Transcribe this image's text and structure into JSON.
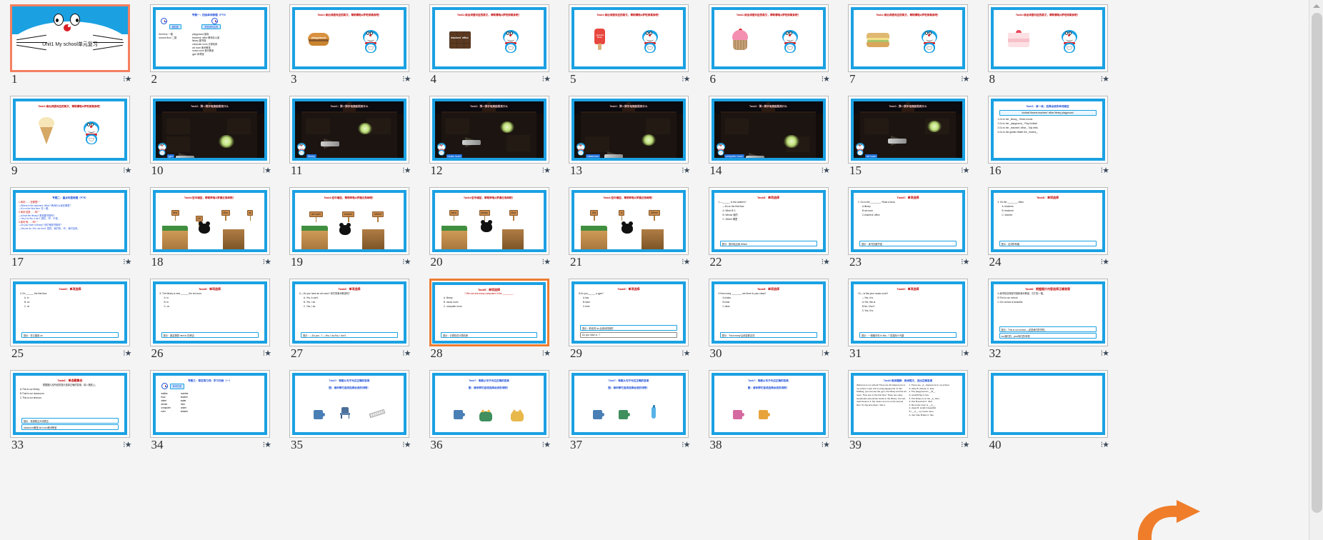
{
  "app": {
    "view": "slide-sorter",
    "accent_selected": "#ed7d31",
    "slide_border": "#1ba1e2",
    "background": "#f4f4f4"
  },
  "scrollbar": {
    "up_arrow": "▲",
    "position": "top"
  },
  "slide1": {
    "title": "Unit1  My school单元复习"
  },
  "slide2": {
    "title": "专题一：四会单词梳理（P70）",
    "col1_label": "楼层数",
    "col2_label": "学校场所名称",
    "col1": [
      "first floor 一楼",
      "second floor 二楼"
    ],
    "col2": [
      "playground 操场",
      "teachers' office 教师办公室",
      "library 图书馆",
      "computer room 计算机房",
      "art room 美术教室",
      "music room 音乐教室",
      "gym 体育馆"
    ]
  },
  "task1": {
    "title": "Task1:读出词语对应的英文，帮助哪啦A梦吃掉美食吧！",
    "items": [
      {
        "n": 3,
        "word": "playground",
        "food": "burger"
      },
      {
        "n": 4,
        "word": "teachers' office",
        "food": "chocolate"
      },
      {
        "n": 5,
        "word": "second floor",
        "food": "popsicle"
      },
      {
        "n": 6,
        "word": "",
        "food": "cupcake"
      },
      {
        "n": 7,
        "word": "",
        "food": "sandwich"
      },
      {
        "n": 8,
        "word": "",
        "food": "cake"
      },
      {
        "n": 9,
        "word": "",
        "food": "ice-cream"
      }
    ]
  },
  "task2": {
    "title": "Task2：猜一猜手电筒能照亮什么",
    "tags": [
      "gym",
      "library",
      "music room",
      "classroom",
      "computer room",
      "art room"
    ],
    "slides": [
      10,
      11,
      12,
      13,
      14,
      15
    ]
  },
  "slide16": {
    "title": "Task3：读一读，选择合适的单词填空",
    "wordbank": "football   flowers   teachers' office   library   playground",
    "lines": [
      "1.Go to the _library_. Read a book.",
      "2.Go to the _playground_. Play football.",
      "3.Go to the _teachers' office_. Say hello.",
      "4.Go to the garden.Water the _flowers_."
    ]
  },
  "slide17": {
    "title": "专题二：重点句型梳理（P75）",
    "lines": [
      "1.询问“……在哪里？”",
      "—Where is the teachers' office?  教师办公室在哪里？",
      "—It's on the first floor.  在一楼。",
      "2.询问“这是……吗？”",
      "—Is that the library?  那是图书馆吗？",
      "—Yes,it is./No, it isn't.  是的。/不，不是。",
      "3.询问“有……吗？”",
      "—Do you have a library?  你们有图书馆吗？",
      "—Yes,we do. /No, we don't.  是的，我们有。/不，我们没有。"
    ]
  },
  "task4": {
    "title": "Task4:空中填空，帮助哆啦A梦通过岛屿吧！",
    "signs": [
      [
        "first",
        "the",
        "floor",
        "at"
      ],
      [
        "art room",
        "teacher",
        "Where",
        ""
      ],
      [
        "have",
        "library",
        "",
        ""
      ],
      [
        "this",
        "is",
        "",
        ""
      ]
    ],
    "slides": [
      18,
      19,
      20,
      21
    ]
  },
  "task5": {
    "title": "Task5：单项选择",
    "slides": [
      {
        "n": 22,
        "q": "1.—______ is the canteen?",
        "a": "—It's on the first floor.",
        "opts": [
          "A. What  什么",
          "B. Whose  谁的",
          "C. Where  哪里"
        ],
        "tip": "提示：提问地点用 Where"
      },
      {
        "n": 23,
        "q": "2. Go to the ________. Read a book.",
        "opts": [
          "A.library",
          "B.art room",
          "C.teachers' office"
        ],
        "tip": "提示：读书去图书馆"
      },
      {
        "n": 24,
        "q": "3. It's the ________ office.",
        "opts": [
          "A. teachers",
          "B. teachers'",
          "C. teacher"
        ],
        "tip": "提示：名词所有格"
      },
      {
        "n": 25,
        "q": "4. It's ______ the first floor.",
        "opts": [
          "A. in",
          "B. on",
          "C. at"
        ],
        "tip": "提示：在几楼用 on"
      },
      {
        "n": 26,
        "q": "5. The library is next ______ the art room.",
        "opts": [
          "A. in",
          "B. to",
          "C. on"
        ],
        "tip": "提示：固定搭配 next to 在旁边"
      },
      {
        "n": 27,
        "q": "6.—Do you have an art room? 你们有美术教室吗？",
        "opts": [
          "A. Yes, it can't.",
          "B. Yes, I do.",
          "C. Yes, I do."
        ],
        "tip": "提示：—Do you...? —Yes, I do./No, I don't."
      },
      {
        "n": 28,
        "q": "7.We can see many computers in the ________.",
        "opts": [
          "A. library",
          "B. music room",
          "C. computer room"
        ],
        "tip": "提示：计算机在计算机房",
        "selected": true
      },
      {
        "n": 29,
        "q": "8.Do you______ a gym?",
        "opts": [
          "A.has",
          "B.have",
          "C.here"
        ],
        "tip": "提示：助动词 do 后用动词原形",
        "extra": "Do you have a...?"
      },
      {
        "n": 30,
        "q": "9.How many ________ are there in your class?",
        "opts": [
          "A.chairs",
          "B.chair",
          "C.desk"
        ],
        "tip": "提示：“How many”后用复数名词"
      },
      {
        "n": 31,
        "q": "10.—Is this your music room?",
        "a": "—Yes, it is.",
        "opts": [
          "A.Yes, this is.",
          "B.No, it isn't.",
          "C.Yes, it is."
        ],
        "tip": "提示：一般疑问句 Is this...? 答语用 it 代替"
      }
    ]
  },
  "slide32": {
    "title": "Task6：根据图片内容选择正确答案",
    "lines": [
      "A.我学校没有图书馆和美术教室，它们在一楼。",
      "B.This is our school.",
      "C.Our school is beautiful."
    ],
    "tip": "提示：This is our school.—这是我们的学校；",
    "tip2": "our我们的，your你们的/你的"
  },
  "slide33": {
    "title": "Task6：单选题集合",
    "sub": "根据图片及所给的提示选择正确的答案，填入横线上。",
    "lines": [
      "A.This is our library.",
      "B.That is our classroom.",
      "C.This is our artroom."
    ],
    "tip": "提示：常用物主代词表达",
    "tip2": "classroom教室   art room美术教室"
  },
  "slide34": {
    "title": "专题三：现在观习词：学习归纳（一）",
    "label": "单词归类",
    "col1": [
      "walker",
      "floor",
      "sister",
      "dinner",
      "computer",
      "ruler"
    ],
    "col2": [
      "number",
      "brother",
      "water",
      "river",
      "under",
      "answer"
    ]
  },
  "task7": {
    "title": "Task7：笔都从句子光边正确的答案",
    "sub": "图：请你帮忙连线选择合适的词吧！",
    "slides": [
      35,
      36,
      37,
      38
    ]
  },
  "slide39": {
    "title": "Task8 阅读理解：阅读短文，选出正确答案",
    "passage": "Welcome to my school! There are 40 classrooms in my school. Look, this is a big playground. In this building, you can see the gym, the library and the art room. They are on the first floor. There are many storybooks and picture books in the library. You can read books in it. My music room is on the second floor. It's big and clean. I like it.",
    "questions": [
      "1. There are _A_ classrooms in my school.",
      "A. thirty  B. thirteen  C. forty",
      "2. The playground is __B__.",
      "A. small  B.big  C.nice",
      "3. The library is on the _A_ floor.",
      "A. first   B.second   C. third",
      "4. My music room is __A__.",
      "A. clean   B. small   C.beautiful",
      "5.I __C__ my music room.",
      "A. don't like  B.likes   C. like"
    ]
  },
  "slide_numbers": [
    1,
    2,
    3,
    4,
    5,
    6,
    7,
    8,
    9,
    10,
    11,
    12,
    13,
    14,
    15,
    16,
    17,
    18,
    19,
    20,
    21,
    22,
    23,
    24,
    25,
    26,
    27,
    28,
    29,
    30,
    31,
    32,
    33,
    34,
    35,
    36,
    37,
    38,
    39,
    40
  ],
  "animation_badge": "⭐"
}
